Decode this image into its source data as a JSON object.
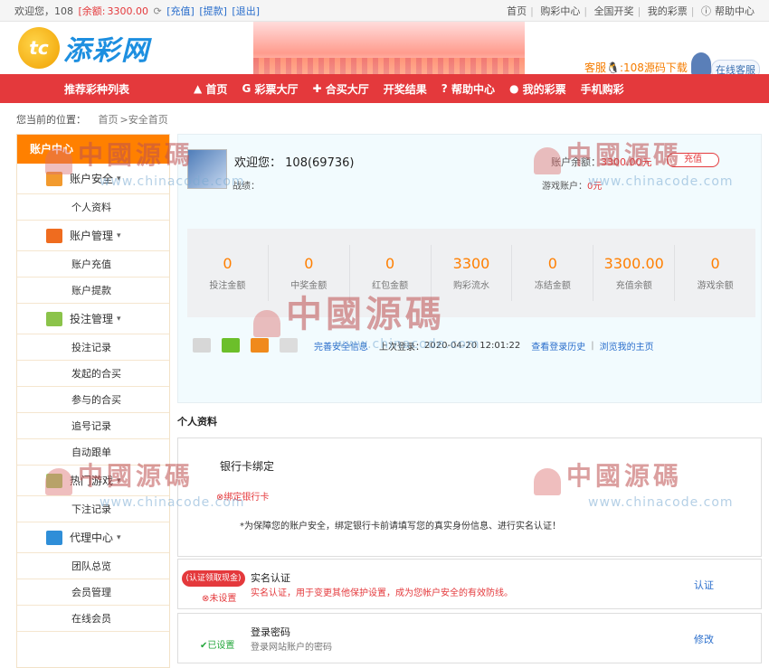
{
  "topbar": {
    "welcome": "欢迎您，108",
    "balance_label": "[余额:",
    "balance_value": "3300.00",
    "refresh_icon": "refresh-icon",
    "recharge": "[充值]",
    "withdraw": "[提款]",
    "logout": "[退出]",
    "links": [
      "首页",
      "购彩中心",
      "全国开奖",
      "我的彩票"
    ],
    "help": "帮助中心"
  },
  "header": {
    "logo_mark": "tc",
    "logo_text": "添彩网",
    "service": "客服",
    "download": ":108源码下载",
    "online_service": "在线客服"
  },
  "nav": {
    "left": "推荐彩种列表",
    "items": [
      "首页",
      "彩票大厅",
      "合买大厅",
      "开奖结果",
      "帮助中心",
      "我的彩票",
      "手机购彩"
    ]
  },
  "breadcrumb": {
    "label": "您当前的位置：",
    "home": "首页",
    "current": ">安全首页"
  },
  "sidebar": {
    "header": "账户中心",
    "sections": [
      {
        "label": "账户安全",
        "items": [
          "个人资料"
        ]
      },
      {
        "label": "账户管理",
        "items": [
          "账户充值",
          "账户提款"
        ]
      },
      {
        "label": "投注管理",
        "items": [
          "投注记录",
          "发起的合买",
          "参与的合买",
          "追号记录",
          "自动跟单"
        ]
      },
      {
        "label": "热门游戏",
        "items": [
          "下注记录"
        ]
      },
      {
        "label": "代理中心",
        "items": [
          "团队总览",
          "会员管理",
          "在线会员"
        ]
      }
    ]
  },
  "profile": {
    "greeting": "欢迎您：",
    "user": "108(69736)",
    "record_label": "战绩：",
    "account_balance_label": "账户余额：",
    "account_balance": "3300.00元",
    "recharge_btn": "充值",
    "game_account_label": "游戏账户：",
    "game_account": "0元"
  },
  "stats": [
    {
      "value": "0",
      "label": "投注金额"
    },
    {
      "value": "0",
      "label": "中奖金额"
    },
    {
      "value": "0",
      "label": "红包金额"
    },
    {
      "value": "3300",
      "label": "购彩流水"
    },
    {
      "value": "0",
      "label": "冻结金额"
    },
    {
      "value": "3300.00",
      "label": "充值余额"
    },
    {
      "value": "0",
      "label": "游戏余额"
    }
  ],
  "actions": {
    "complete_info": "完善安全信息",
    "last_login_label": "上次登录：",
    "last_login_time": "2020-04-20 12:01:22",
    "login_history": "查看登录历史",
    "my_home": "浏览我的主页"
  },
  "personal": {
    "title": "个人资料",
    "bank_title": "银行卡绑定",
    "bank_status": "绑定银行卡",
    "bank_tip": "*为保障您的账户安全，绑定银行卡前请填写您的真实身份信息、进行实名认证！",
    "realname_badge": "(认证领取现金)",
    "realname_state": "未设置",
    "realname_title": "实名认证",
    "realname_desc": "实名认证，用于变更其他保护设置，成为您帐户安全的有效防线。",
    "realname_action": "认证",
    "pwd_state": "已设置",
    "pwd_title": "登录密码",
    "pwd_desc": "登录网站账户的密码",
    "pwd_action": "修改"
  },
  "watermark": {
    "cn": "中國源碼",
    "url": "www.chinacode.com"
  },
  "colors": {
    "brand_red": "#e4393c",
    "orange": "#ff8000",
    "link_blue": "#2a6ecc"
  }
}
